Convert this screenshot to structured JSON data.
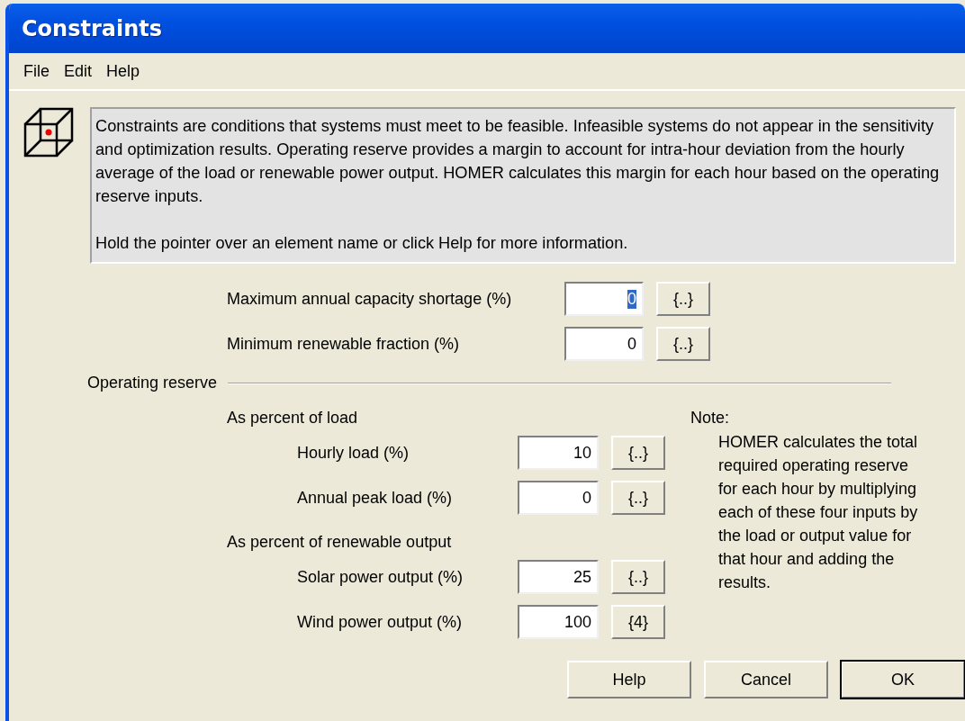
{
  "window": {
    "title": "Constraints"
  },
  "menu": [
    "File",
    "Edit",
    "Help"
  ],
  "info": {
    "paragraphs": [
      "Constraints are conditions that systems must meet to be feasible. Infeasible systems do not appear in the sensitivity and optimization results. Operating reserve provides a margin to account for intra-hour deviation from the hourly average of the load or renewable power output. HOMER calculates this margin for each hour based on the operating reserve inputs.",
      "Hold the pointer over an element name or click Help for more information."
    ]
  },
  "constraints": [
    {
      "label": "Maximum annual capacity shortage (%)",
      "value": "0",
      "text_selected": true,
      "sensitivity": "{..}"
    },
    {
      "label": "Minimum renewable fraction (%)",
      "value": "0",
      "text_selected": false,
      "sensitivity": "{..}"
    }
  ],
  "operating_reserve": {
    "title": "Operating reserve",
    "groups": [
      {
        "heading": "As percent of load",
        "rows": [
          {
            "label": "Hourly load (%)",
            "value": "10",
            "text_selected": false,
            "sensitivity": "{..}"
          },
          {
            "label": "Annual peak load (%)",
            "value": "0",
            "text_selected": false,
            "sensitivity": "{..}"
          }
        ]
      },
      {
        "heading": "As percent of renewable output",
        "rows": [
          {
            "label": "Solar power output (%)",
            "value": "25",
            "text_selected": false,
            "sensitivity": "{..}"
          },
          {
            "label": "Wind power output (%)",
            "value": "100",
            "text_selected": false,
            "sensitivity": "{4}"
          }
        ]
      }
    ],
    "note": {
      "heading": "Note:",
      "text": "HOMER calculates the total required operating reserve for each hour by multiplying each of these four inputs by the load or output value for that hour and adding the results."
    }
  },
  "buttons": [
    {
      "label": "Help",
      "default": false
    },
    {
      "label": "Cancel",
      "default": false
    },
    {
      "label": "OK",
      "default": true
    }
  ]
}
